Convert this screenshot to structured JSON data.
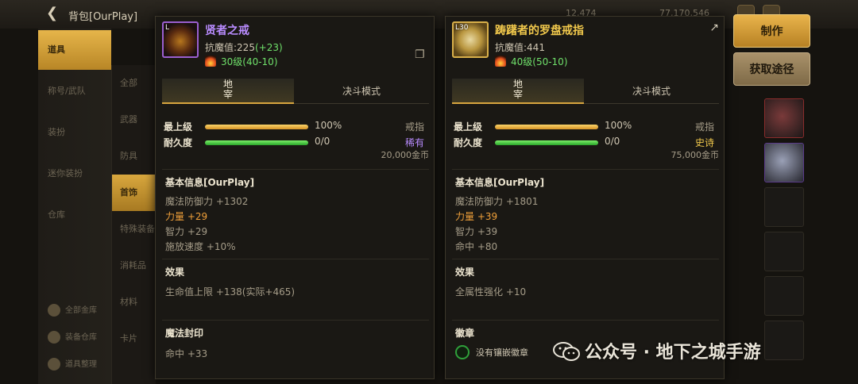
{
  "header": {
    "back_label": "背包[OurPlay]",
    "stat1": "12,474",
    "stat2": "77,170,546"
  },
  "left_nav": [
    {
      "label": "道具",
      "active": true
    },
    {
      "label": "称号/武队",
      "active": false
    },
    {
      "label": "装扮",
      "active": false
    },
    {
      "label": "迷你装扮",
      "active": false
    },
    {
      "label": "仓库",
      "active": false
    }
  ],
  "sub_nav": [
    {
      "label": "全部",
      "active": false
    },
    {
      "label": "武器",
      "active": false
    },
    {
      "label": "防具",
      "active": false
    },
    {
      "label": "首饰",
      "active": true
    },
    {
      "label": "特殊装备",
      "active": false
    },
    {
      "label": "消耗品",
      "active": false
    },
    {
      "label": "材料",
      "active": false
    },
    {
      "label": "卡片",
      "active": false
    }
  ],
  "bottom_links": [
    "全部金库",
    "装备仓库",
    "道具整理"
  ],
  "actions": {
    "make": "制作",
    "source": "获取途径"
  },
  "panel1": {
    "icon_level": "L",
    "name": "贤者之戒",
    "resist_label": "抗魔值:225",
    "resist_plus": "(+23)",
    "level": "30级(40-10)",
    "tab_dungeon": "地\n宰",
    "tab_duel": "决斗模式",
    "max_level_label": "最上级",
    "max_level_value": "100%",
    "max_level_fraction": 1.0,
    "durability_label": "耐久度",
    "durability_value": "0/0",
    "durability_fraction": 1.0,
    "category": "戒指",
    "rarity": "稀有",
    "price": "20,000金币",
    "basic_title": "基本信息[OurPlay]",
    "basic_stats": [
      {
        "text": "魔法防御力 +1302",
        "gold": false
      },
      {
        "text": "力量 +29",
        "gold": true
      },
      {
        "text": "智力 +29",
        "gold": false
      },
      {
        "text": "施放速度 +10%",
        "gold": false
      }
    ],
    "effect_title": "效果",
    "effect_text": "生命值上限 +138(实际+465)",
    "seal_title": "魔法封印",
    "seal_text": "命中 +33"
  },
  "panel2": {
    "icon_level": "L30",
    "name": "踌躇者的罗盘戒指",
    "resist_label": "抗魔值:441",
    "level": "40级(50-10)",
    "tab_dungeon": "地\n宰",
    "tab_duel": "决斗模式",
    "max_level_label": "最上级",
    "max_level_value": "100%",
    "max_level_fraction": 1.0,
    "durability_label": "耐久度",
    "durability_value": "0/0",
    "durability_fraction": 1.0,
    "category": "戒指",
    "rarity": "史诗",
    "price": "75,000金币",
    "basic_title": "基本信息[OurPlay]",
    "basic_stats": [
      {
        "text": "魔法防御力 +1801",
        "gold": false
      },
      {
        "text": "力量 +39",
        "gold": true
      },
      {
        "text": "智力 +39",
        "gold": false
      },
      {
        "text": "命中 +80",
        "gold": false
      }
    ],
    "effect_title": "效果",
    "effect_text": "全属性强化 +10",
    "badge_title": "徽章",
    "badge_text": "没有镶嵌徽章"
  },
  "watermark": "公众号 · 地下之城手游",
  "colors": {
    "epic": "#f2c94c",
    "rare": "#b98cff",
    "accent": "#d8a53f",
    "green": "#6fe06a"
  }
}
